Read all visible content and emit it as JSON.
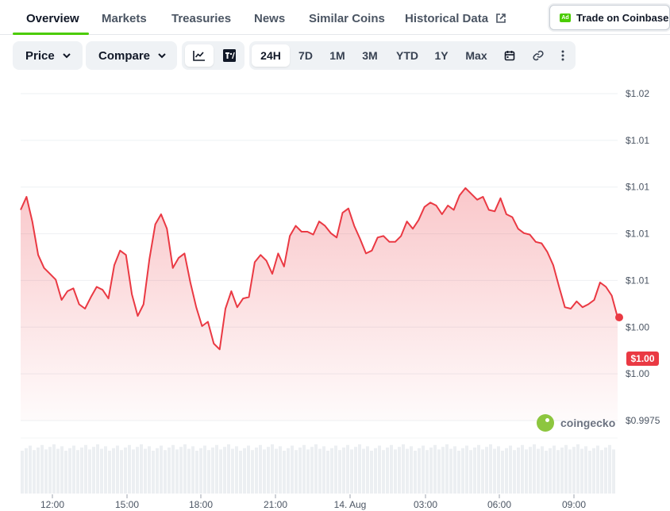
{
  "tabs": [
    {
      "label": "Overview",
      "active": true
    },
    {
      "label": "Markets"
    },
    {
      "label": "Treasuries"
    },
    {
      "label": "News"
    },
    {
      "label": "Similar Coins"
    },
    {
      "label": "Historical Data"
    }
  ],
  "ad": {
    "badge": "Ad",
    "label": "Trade on Coinbase"
  },
  "controls": {
    "price_dropdown": "Price",
    "compare_dropdown": "Compare",
    "chart_types": [
      "line-chart-icon",
      "tradingview-icon"
    ],
    "selected_chart_type": "line-chart-icon",
    "ranges": [
      "24H",
      "7D",
      "1M",
      "3M",
      "YTD",
      "1Y",
      "Max"
    ],
    "selected_range": "24H",
    "extra_icons": [
      "calendar-icon",
      "link-icon",
      "more-icon"
    ]
  },
  "watermark": "coingecko",
  "colors": {
    "line": "#ea3943",
    "accent": "#4bcc00",
    "price_tag": "#ea3943"
  },
  "chart_data": {
    "type": "area",
    "y_ticks": [
      "$1.02",
      "$1.01",
      "$1.01",
      "$1.01",
      "$1.01",
      "$1.00",
      "$1.00",
      "$0.9975"
    ],
    "x_ticks": [
      "12:00",
      "15:00",
      "18:00",
      "21:00",
      "14. Aug",
      "03:00",
      "06:00",
      "09:00"
    ],
    "current_price_label": "$1.00",
    "ylim": [
      0.9975,
      1.02
    ],
    "grid": true,
    "series": [
      {
        "values": [
          1.012,
          1.0129,
          1.0112,
          1.0089,
          1.008,
          1.0076,
          1.0072,
          1.0058,
          1.0064,
          1.0066,
          1.0055,
          1.0052,
          1.006,
          1.0067,
          1.0065,
          1.0059,
          1.0082,
          1.0092,
          1.0089,
          1.0062,
          1.0047,
          1.0055,
          1.0086,
          1.011,
          1.0117,
          1.0107,
          1.008,
          1.0087,
          1.009,
          1.007,
          1.0053,
          1.004,
          1.0043,
          1.0028,
          1.0024,
          1.0052,
          1.0064,
          1.0053,
          1.0059,
          1.006,
          1.0084,
          1.0089,
          1.0085,
          1.0076,
          1.009,
          1.0081,
          1.0102,
          1.0109,
          1.0105,
          1.0105,
          1.0103,
          1.0112,
          1.0109,
          1.0104,
          1.0101,
          1.0118,
          1.0121,
          1.0109,
          1.01,
          1.009,
          1.0092,
          1.0101,
          1.0102,
          1.0098,
          1.0098,
          1.0102,
          1.0112,
          1.0107,
          1.0113,
          1.0122,
          1.0125,
          1.0123,
          1.0117,
          1.0123,
          1.012,
          1.013,
          1.0135,
          1.0131,
          1.0127,
          1.0129,
          1.012,
          1.0119,
          1.0128,
          1.0117,
          1.0115,
          1.0107,
          1.0104,
          1.0103,
          1.0098,
          1.0097,
          1.0091,
          1.0082,
          1.0067,
          1.0053,
          1.0052,
          1.0057,
          1.0053,
          1.0055,
          1.0058,
          1.007,
          1.0067,
          1.0061,
          1.0046
        ],
        "color": "#ea3943"
      }
    ]
  }
}
